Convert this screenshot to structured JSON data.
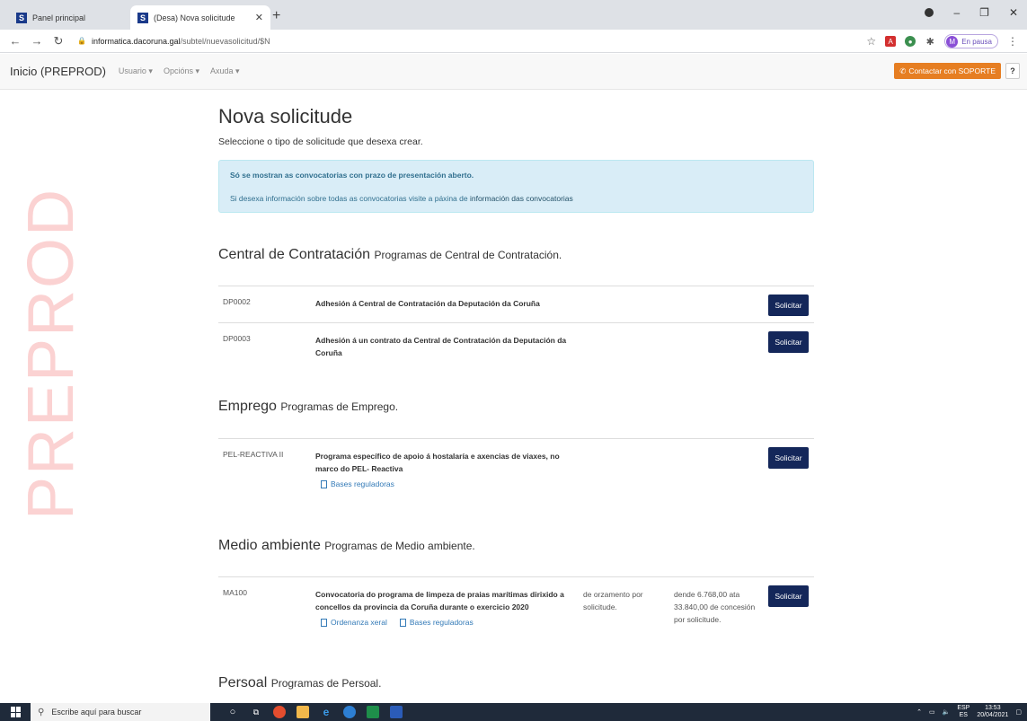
{
  "browser": {
    "tabs": [
      {
        "title": "Panel principal",
        "favicon": "S"
      },
      {
        "title": "(Desa) Nova solicitude",
        "favicon": "S"
      }
    ],
    "url_host": "informatica.dacoruna.gal",
    "url_path": "/subtel/nuevasolicitud/$N",
    "profile_initial": "M",
    "profile_label": "En pausa"
  },
  "navbar": {
    "brand": "Inicio (PREPROD)",
    "menu": [
      "Usuario ▾",
      "Opcións ▾",
      "Axuda ▾"
    ],
    "support_label": "Contactar con SOPORTE",
    "help_label": "?"
  },
  "watermark": "PREPROD",
  "page": {
    "title": "Nova solicitude",
    "subtitle": "Seleccione o tipo de solicitude que desexa crear.",
    "alert_line1": "Só se mostran as convocatorias con prazo de presentación aberto.",
    "alert_line2_prefix": "Si desexa información sobre todas as convocatorias visite a páxina de",
    "alert_line2_link": "información das convocatorias"
  },
  "sections": [
    {
      "title": "Central de Contratación",
      "subtitle": "Programas de Central de Contratación.",
      "rows": [
        {
          "code": "DP0002",
          "desc": "Adhesión á Central de Contratación da Deputación da Coruña",
          "button": "Solicitar"
        },
        {
          "code": "DP0003",
          "desc": "Adhesión á un contrato da Central de Contratación da Deputación da Coruña",
          "button": "Solicitar"
        }
      ]
    },
    {
      "title": "Emprego",
      "subtitle": "Programas de Emprego.",
      "rows": [
        {
          "code": "PEL-REACTIVA II",
          "desc": "Programa específico de apoio á hostalaría e axencias de viaxes, no marco do PEL- Reactiva",
          "docs": [
            "Bases reguladoras"
          ],
          "button": "Solicitar"
        }
      ]
    },
    {
      "title": "Medio ambiente",
      "subtitle": "Programas de Medio ambiente.",
      "rows": [
        {
          "code": "MA100",
          "desc": "Convocatoria do programa de limpeza de praias marítimas dirixido a concellos da provincia da Coruña durante o exercicio 2020",
          "col3": "de orzamento por solicitude.",
          "col4": "dende 6.768,00 ata 33.840,00 de concesión por solicitude.",
          "docs": [
            "Ordenanza xeral",
            "Bases reguladoras"
          ],
          "button": "Solicitar"
        }
      ]
    },
    {
      "title": "Persoal",
      "subtitle": "Programas de Persoal.",
      "rows": []
    }
  ],
  "taskbar": {
    "search_placeholder": "Escribe aquí para buscar",
    "lang": "ESP",
    "lang_sub": "ES",
    "time": "13:53",
    "date": "20/04/2021"
  }
}
